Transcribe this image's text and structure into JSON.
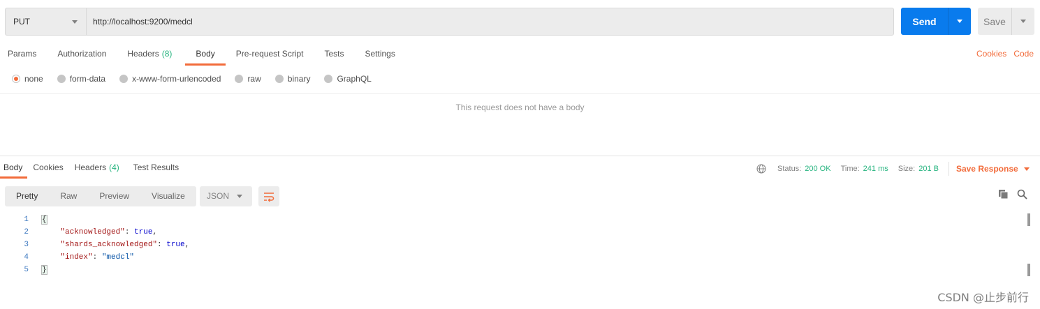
{
  "request": {
    "method": "PUT",
    "url": "http://localhost:9200/medcl",
    "send_label": "Send",
    "save_label": "Save",
    "tabs": [
      {
        "label": "Params"
      },
      {
        "label": "Authorization"
      },
      {
        "label": "Headers",
        "count": "(8)"
      },
      {
        "label": "Body",
        "active": true
      },
      {
        "label": "Pre-request Script"
      },
      {
        "label": "Tests"
      },
      {
        "label": "Settings"
      }
    ],
    "cookies_link": "Cookies",
    "code_link": "Code",
    "body_types": [
      "none",
      "form-data",
      "x-www-form-urlencoded",
      "raw",
      "binary",
      "GraphQL"
    ],
    "selected_body_type": "none",
    "empty_body_message": "This request does not have a body"
  },
  "response": {
    "tabs": [
      {
        "label": "Body",
        "active": true
      },
      {
        "label": "Cookies"
      },
      {
        "label": "Headers",
        "count": "(4)"
      },
      {
        "label": "Test Results"
      }
    ],
    "status_label": "Status:",
    "status_value": "200 OK",
    "time_label": "Time:",
    "time_value": "241 ms",
    "size_label": "Size:",
    "size_value": "201 B",
    "save_response_label": "Save Response",
    "format_tabs": [
      "Pretty",
      "Raw",
      "Preview",
      "Visualize"
    ],
    "active_format": "Pretty",
    "language": "JSON",
    "body_lines": [
      {
        "n": "1",
        "text": "{"
      },
      {
        "n": "2",
        "key": "\"acknowledged\"",
        "value": "true",
        "type": "kw",
        "comma": ","
      },
      {
        "n": "3",
        "key": "\"shards_acknowledged\"",
        "value": "true",
        "type": "kw",
        "comma": ","
      },
      {
        "n": "4",
        "key": "\"index\"",
        "value": "\"medcl\"",
        "type": "str",
        "comma": ""
      },
      {
        "n": "5",
        "text": "}"
      }
    ]
  },
  "watermark": "CSDN @止步前行",
  "colors": {
    "accent": "#f26b3a",
    "send": "#097bed",
    "ok": "#26b47f"
  }
}
